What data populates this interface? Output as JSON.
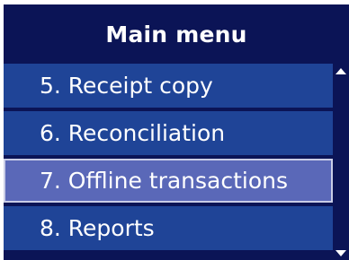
{
  "header": {
    "title": "Main menu"
  },
  "menu": {
    "items": [
      {
        "label": "5. Receipt copy",
        "selected": false
      },
      {
        "label": "6. Reconciliation",
        "selected": false
      },
      {
        "label": "7. Offline transactions",
        "selected": true
      },
      {
        "label": "8. Reports",
        "selected": false
      }
    ]
  },
  "scrollbar": {
    "up_icon": "arrow-up-icon",
    "down_icon": "arrow-down-icon"
  },
  "colors": {
    "background": "#0b1456",
    "item": "#1f4497",
    "selected_item": "#5a68b8",
    "text": "#ffffff"
  }
}
